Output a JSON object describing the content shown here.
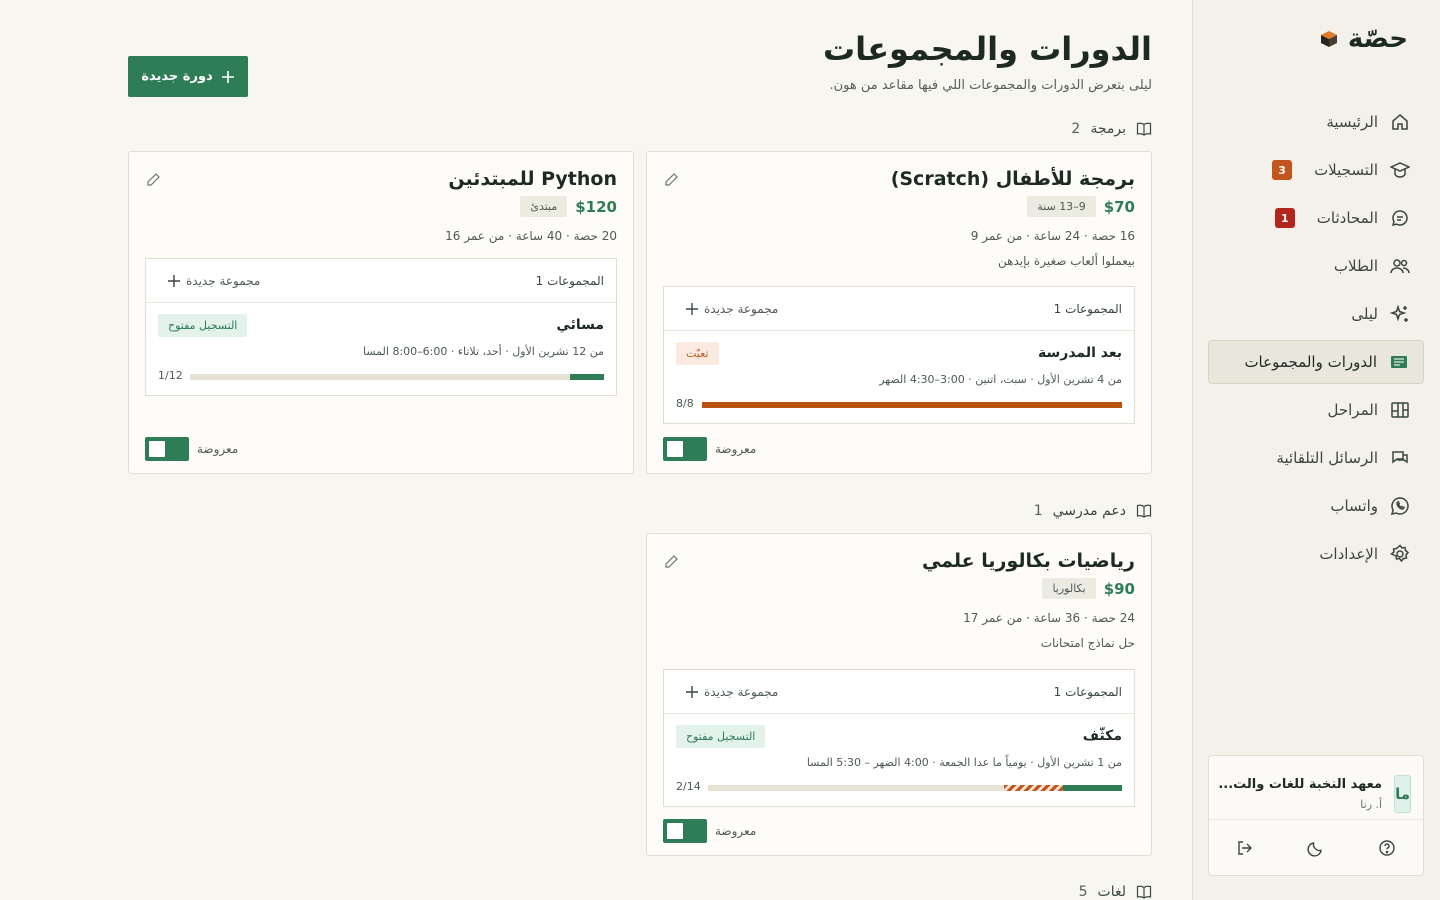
{
  "app": {
    "brand": "حصّة"
  },
  "sidebar": {
    "items": [
      {
        "label": "الرئيسية",
        "icon": "home-icon",
        "badge": null
      },
      {
        "label": "التسجيلات",
        "icon": "graduation-cap-icon",
        "badge": "3",
        "badge_color": "#c0561e"
      },
      {
        "label": "المحادثات",
        "icon": "chat-icon",
        "badge": "1",
        "badge_color": "#b3261e"
      },
      {
        "label": "الطلاب",
        "icon": "users-icon",
        "badge": null
      },
      {
        "label": "ليلى",
        "icon": "sparkles-icon",
        "badge": null
      },
      {
        "label": "الدورات والمجموعات",
        "icon": "courses-icon",
        "badge": null,
        "active": true
      },
      {
        "label": "المراحل",
        "icon": "kanban-icon",
        "badge": null
      },
      {
        "label": "الرسائل التلقائية",
        "icon": "messages-icon",
        "badge": null
      },
      {
        "label": "واتساب",
        "icon": "whatsapp-icon",
        "badge": null
      },
      {
        "label": "الإعدادات",
        "icon": "gear-icon",
        "badge": null
      }
    ],
    "account": {
      "avatar": "ما",
      "name": "معهد النخبة للغات والت...",
      "user": "أ. رنا"
    }
  },
  "main": {
    "title": "الدورات والمجموعات",
    "subtitle": "ليلى بتعرض الدورات والمجموعات اللي فيها مقاعد من هون.",
    "new_course_label": "دورة جديدة",
    "groups_label": "المجموعات",
    "new_group_label": "مجموعة جديدة",
    "visible_label": "معروضة",
    "sections": [
      {
        "name": "برمجة",
        "count": "2"
      },
      {
        "name": "دعم مدرسي",
        "count": "1"
      },
      {
        "name": "لغات",
        "count": "5"
      }
    ],
    "courses": [
      {
        "title": "برمجة للأطفال (Scratch)",
        "price": "$70",
        "tag": "9–13 سنة",
        "meta": "16 حصة · 24 ساعة · من عمر 9",
        "desc": "بيعملوا ألعاب صغيرة بإيدهن",
        "groups_count": "1",
        "visible": true,
        "groups": [
          {
            "name": "بعد المدرسة",
            "status": "تعبّت",
            "status_type": "full",
            "schedule": "من 4 تشرين الأول · سبت، اتنين · 3:00–4:30 الضهر",
            "count_text": "8/8",
            "filled": 8,
            "capacity": 8
          }
        ]
      },
      {
        "title": "Python للمبتدئين",
        "price": "$120",
        "tag": "مبتدئ",
        "meta": "20 حصة · 40 ساعة · من عمر 16",
        "desc": "",
        "groups_count": "1",
        "visible": true,
        "groups": [
          {
            "name": "مسائي",
            "status": "التسجيل مفتوح",
            "status_type": "open",
            "schedule": "من 12 تشرين الأول · أحد، تلاتاء · 6:00–8:00 المسا",
            "count_text": "1/12",
            "filled": 1,
            "capacity": 12
          }
        ]
      },
      {
        "title": "رياضيات بكالوريا علمي",
        "price": "$90",
        "tag": "بكالوريا",
        "meta": "24 حصة · 36 ساعة · من عمر 17",
        "desc": "حل نماذج امتحانات",
        "groups_count": "1",
        "visible": true,
        "groups": [
          {
            "name": "مكثّف",
            "status": "التسجيل مفتوح",
            "status_type": "open",
            "schedule": "من 1 تشرين الأول · يومياً ما عدا الجمعة · 4:00 الضهر – 5:30 المسا",
            "count_text": "2/14",
            "filled": 2,
            "capacity": 14,
            "pending": 2
          }
        ]
      }
    ]
  },
  "colors": {
    "accent": "#2e7d57",
    "full": "#b8520f",
    "pending": "#c0561e",
    "track": "#e6e3d5"
  }
}
